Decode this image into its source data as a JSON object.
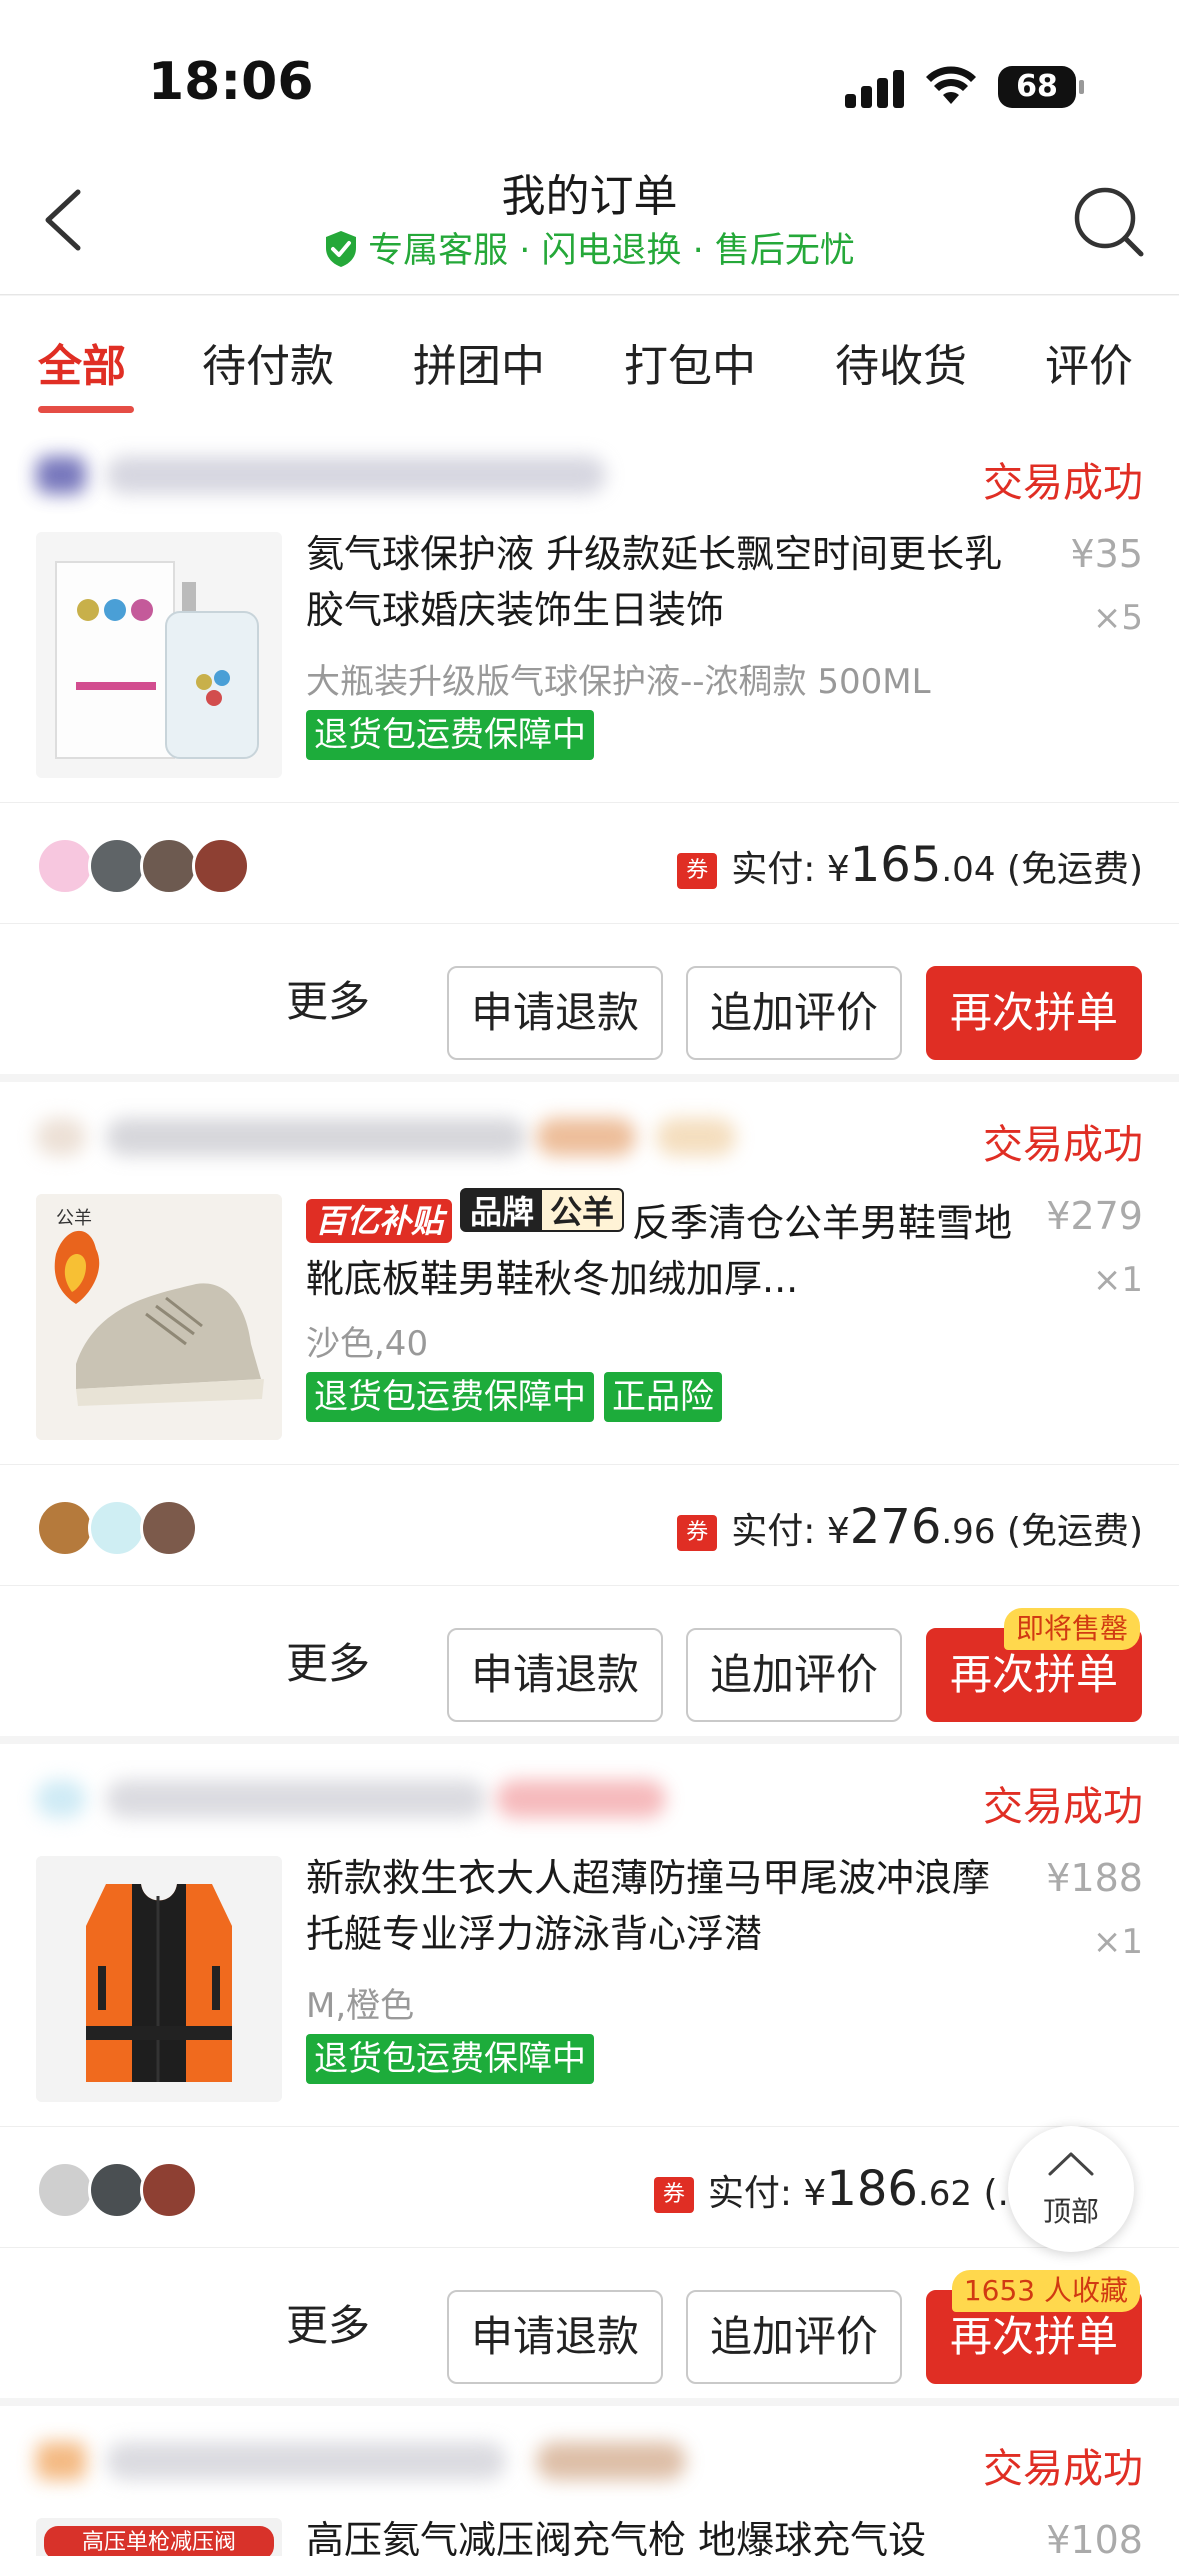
{
  "status_bar": {
    "time": "18:06",
    "battery": "68"
  },
  "nav": {
    "title": "我的订单",
    "subtitle": "专属客服 · 闪电退换 · 售后无忧",
    "icons": {
      "back": "chevron-left-icon",
      "search": "search-icon",
      "shield": "shield-check-icon"
    }
  },
  "tabs": [
    "全部",
    "待付款",
    "拼团中",
    "打包中",
    "待收货",
    "评价"
  ],
  "colors": {
    "accent": "#e02e24",
    "green": "#1dac3b",
    "badge": "#ffd84d"
  },
  "orders": [
    {
      "status": "交易成功",
      "title": "氦气球保护液 升级款延长飘空时间更长乳胶气球婚庆装饰生日装饰",
      "spec": "大瓶装升级版气球保护液--浓稠款 500ML",
      "tags": [
        "退货包运费保障中"
      ],
      "price": "¥35",
      "qty": "×5",
      "pay_label": "实付:",
      "pay_amount": "165",
      "pay_cents": ".04",
      "pay_note": "(免运费)",
      "coupon": "券",
      "more": "更多",
      "btn_refund": "申请退款",
      "btn_review": "追加评价",
      "btn_again": "再次拼单"
    },
    {
      "status": "交易成功",
      "badge_subsidy": "百亿补贴",
      "badge_brand_a": "品牌",
      "badge_brand_b": "公羊",
      "title": "反季清仓公羊男鞋雪地靴底板鞋男鞋秋冬加绒加厚...",
      "spec": "沙色,40",
      "tags": [
        "退货包运费保障中",
        "正品险"
      ],
      "price": "¥279",
      "qty": "×1",
      "pay_label": "实付:",
      "pay_amount": "276",
      "pay_cents": ".96",
      "pay_note": "(免运费)",
      "coupon": "券",
      "more": "更多",
      "btn_refund": "申请退款",
      "btn_review": "追加评价",
      "btn_again": "再次拼单",
      "hint": "即将售罄"
    },
    {
      "status": "交易成功",
      "title": "新款救生衣大人超薄防撞马甲尾波冲浪摩托艇专业浮力游泳背心浮潜",
      "spec": "M,橙色",
      "tags": [
        "退货包运费保障中"
      ],
      "price": "¥188",
      "qty": "×1",
      "pay_label": "实付:",
      "pay_amount": "186",
      "pay_cents": ".62",
      "pay_note": "(.",
      "coupon": "券",
      "more": "更多",
      "btn_refund": "申请退款",
      "btn_review": "追加评价",
      "btn_again": "再次拼单",
      "hint": "1653 人收藏"
    },
    {
      "status": "交易成功",
      "title": "高压氦气减压阀充气枪 地爆球充气设",
      "thumb_label": "高压单枪减压阀",
      "price": "¥108"
    }
  ],
  "back_to_top": "顶部"
}
